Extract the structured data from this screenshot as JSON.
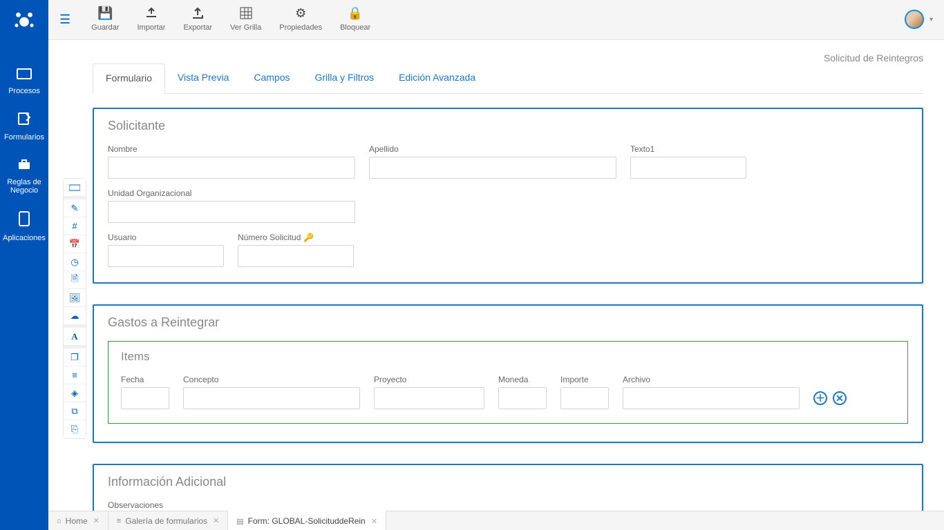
{
  "sidebar": {
    "items": [
      {
        "label": "Procesos"
      },
      {
        "label": "Formularios"
      },
      {
        "label": "Reglas de Negocio"
      },
      {
        "label": "Aplicaciones"
      }
    ]
  },
  "toolbar": {
    "save": "Guardar",
    "import": "Importar",
    "export": "Exportar",
    "viewgrid": "Ver Grilla",
    "properties": "Propiedades",
    "lock": "Bloquear"
  },
  "page": {
    "title_right": "Solicitud de Reintegros"
  },
  "tabs": {
    "form": "Formulario",
    "preview": "Vista Previa",
    "fields": "Campos",
    "grid": "Grilla y Filtros",
    "advanced": "Edición Avanzada"
  },
  "sections": {
    "solicitante": {
      "title": "Solicitante",
      "fields": {
        "nombre": "Nombre",
        "apellido": "Apellido",
        "texto1": "Texto1",
        "unidad": "Unidad Organizacional",
        "usuario": "Usuario",
        "numero": "Número Solicitud"
      }
    },
    "gastos": {
      "title": "Gastos a Reintegrar",
      "items_title": "Items",
      "item_fields": {
        "fecha": "Fecha",
        "concepto": "Concepto",
        "proyecto": "Proyecto",
        "moneda": "Moneda",
        "importe": "Importe",
        "archivo": "Archivo"
      }
    },
    "adicional": {
      "title": "Información Adicional",
      "observaciones": "Observaciones"
    }
  },
  "bottom_tabs": {
    "home": "Home",
    "gallery": "Galería de formularios",
    "form": "Form: GLOBAL-SolicituddeRein"
  }
}
